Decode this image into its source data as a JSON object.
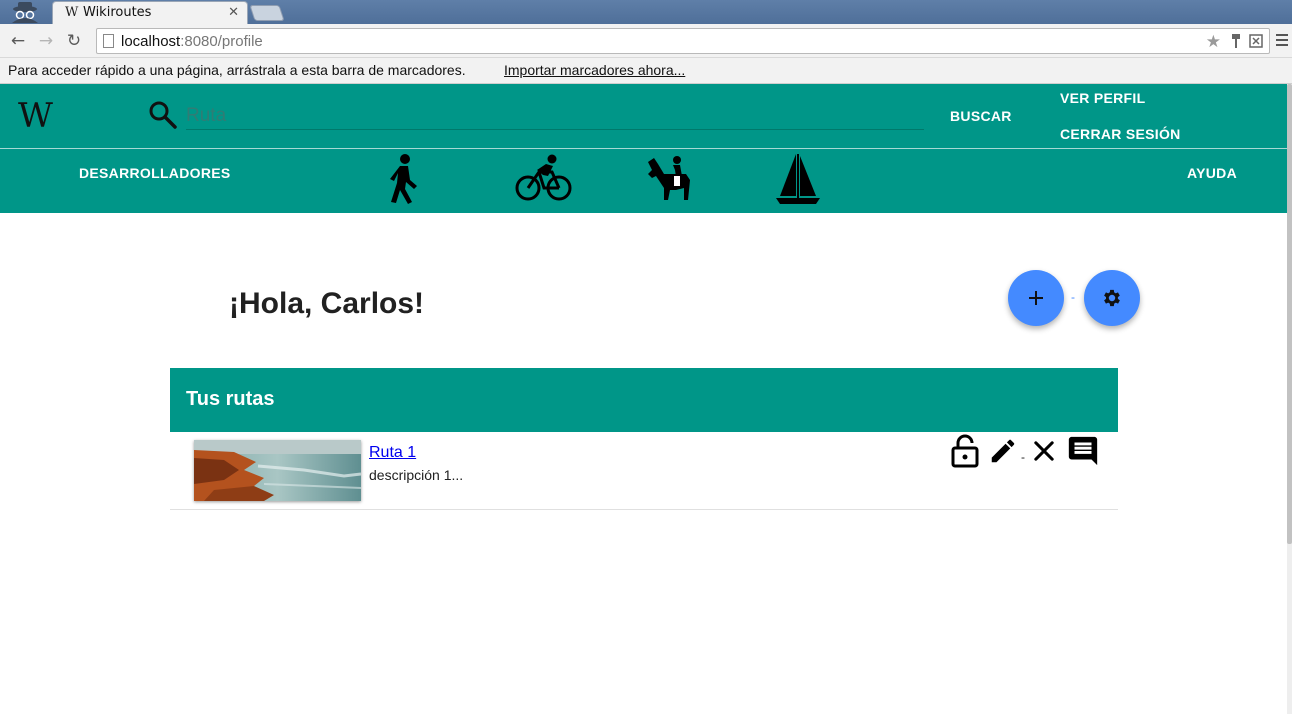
{
  "browser": {
    "tab_title": "Wikiroutes",
    "tab_favicon": "W",
    "url_host": "localhost",
    "url_port_path": ":8080/profile",
    "bookmarks_text": "Para acceder rápido a una página, arrástrala a esta barra de marcadores.",
    "bookmarks_link": "Importar marcadores ahora..."
  },
  "header": {
    "logo": "W",
    "search_placeholder": "Ruta",
    "buscar_label": "BUSCAR",
    "ver_perfil_label": "VER PERFIL",
    "cerrar_sesion_label": "CERRAR SESIÓN",
    "desarrolladores_label": "DESARROLLADORES",
    "ayuda_label": "AYUDA",
    "activity_icons": [
      "walking-icon",
      "cycling-icon",
      "horse-riding-icon",
      "sailing-icon"
    ]
  },
  "main": {
    "greeting": "¡Hola, Carlos!",
    "fab_separator": "-",
    "card_title": "Tus rutas",
    "routes": [
      {
        "name": "Ruta 1",
        "description": "descripción 1...",
        "action_separator": "-"
      }
    ]
  },
  "colors": {
    "header_teal": "#009688",
    "fab_blue": "#448aff",
    "link_blue": "#0000ee"
  }
}
